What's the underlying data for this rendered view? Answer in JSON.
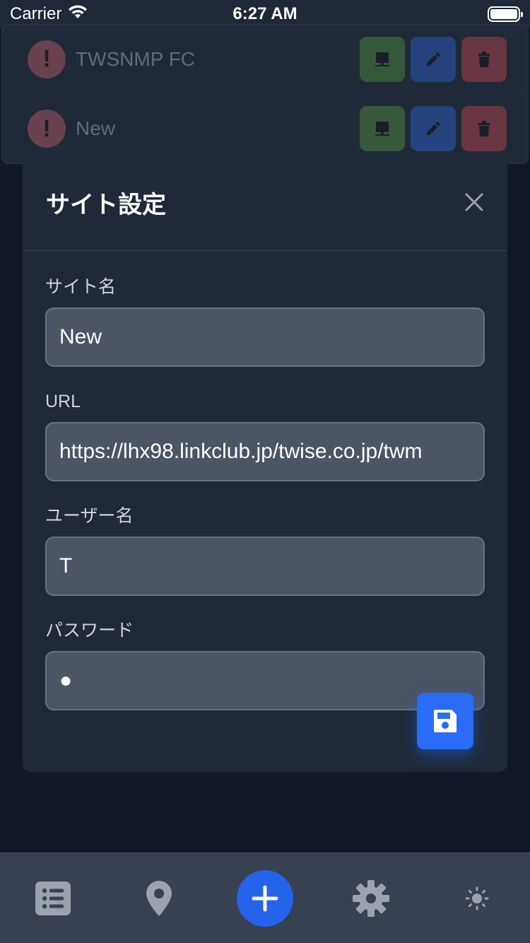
{
  "status_bar": {
    "carrier": "Carrier",
    "time": "6:27 AM",
    "battery_level": 1.0
  },
  "site_list": {
    "items": [
      {
        "name": "TWSNMP FC",
        "status_icon": "exclamation-icon"
      },
      {
        "name": "New",
        "status_icon": "exclamation-icon"
      }
    ],
    "row_actions": [
      "monitor-icon",
      "pencil-icon",
      "trash-icon"
    ]
  },
  "modal": {
    "title": "サイト設定",
    "close_icon": "close-icon",
    "fields": {
      "site_name": {
        "label": "サイト名",
        "value": "New"
      },
      "url": {
        "label": "URL",
        "value": "https://lhx98.linkclub.jp/twise.co.jp/twm"
      },
      "username": {
        "label": "ユーザー名",
        "value": "T"
      },
      "password": {
        "label": "パスワード",
        "value": "●"
      }
    },
    "save_icon": "floppy-disk-icon"
  },
  "tab_bar": {
    "tabs": [
      "list-icon",
      "map-pin-icon",
      "plus-icon",
      "gear-icon",
      "sun-icon"
    ]
  },
  "colors": {
    "background": "#111827",
    "surface": "#1f2937",
    "input": "#4b5563",
    "primary": "#2563eb",
    "green": "#5ea63f",
    "red": "#e34a55"
  }
}
